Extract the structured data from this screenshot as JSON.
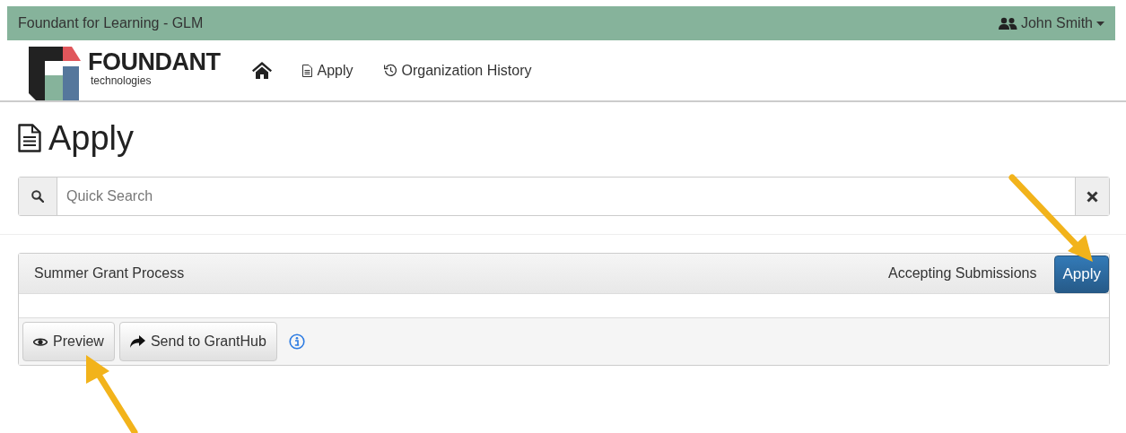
{
  "top_bar": {
    "title": "Foundant for Learning - GLM",
    "user": "John Smith"
  },
  "logo": {
    "name": "FOUNDANT",
    "tagline": "technologies"
  },
  "nav": [
    {
      "kind": "home"
    },
    {
      "kind": "apply",
      "label": "Apply"
    },
    {
      "kind": "history",
      "label": "Organization History"
    }
  ],
  "heading": "Apply",
  "search": {
    "placeholder": "Quick Search"
  },
  "process": {
    "title": "Summer Grant Process",
    "status": "Accepting Submissions",
    "apply_button": "Apply",
    "actions": [
      {
        "kind": "preview",
        "label": "Preview"
      },
      {
        "kind": "send",
        "label": "Send to GrantHub"
      },
      {
        "kind": "info"
      }
    ]
  }
}
